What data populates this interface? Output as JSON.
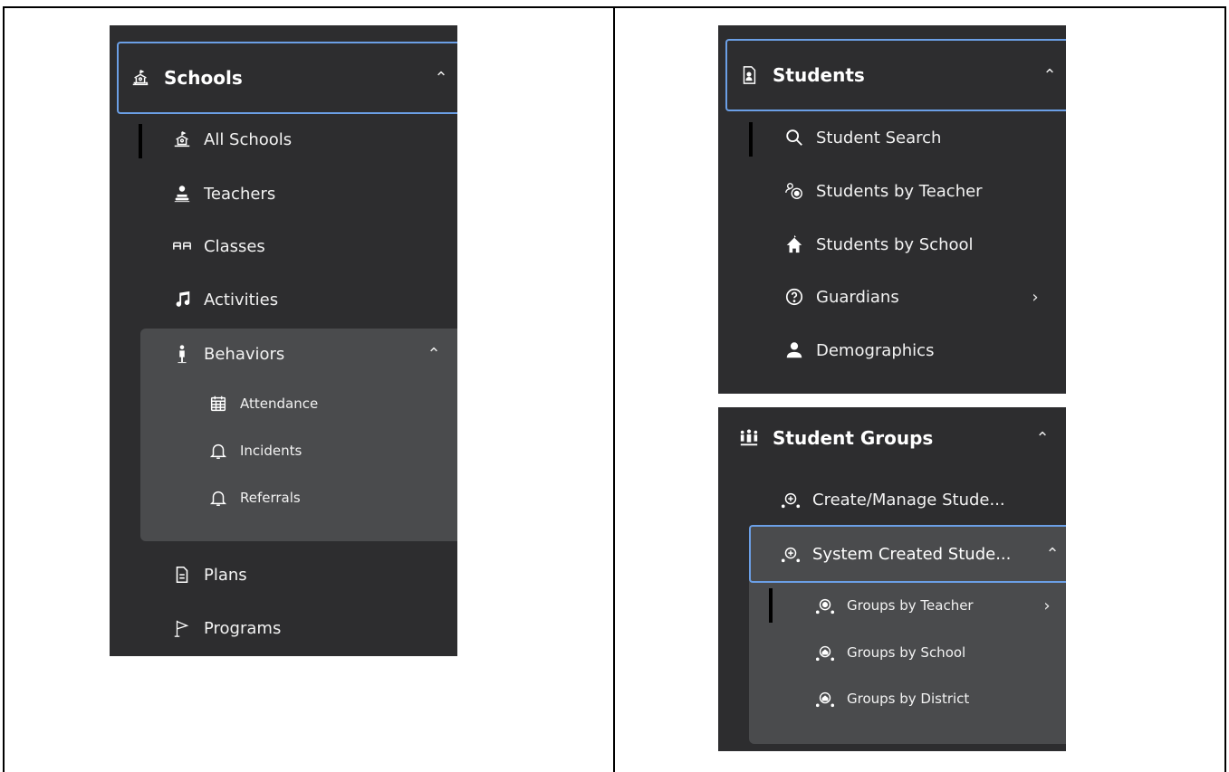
{
  "schools_panel": {
    "header": {
      "label": "Schools",
      "icon": "school-icon"
    },
    "items": [
      {
        "label": "All Schools",
        "icon": "school-icon"
      },
      {
        "label": "Teachers",
        "icon": "teacher-icon"
      },
      {
        "label": "Classes",
        "icon": "classes-icon"
      },
      {
        "label": "Activities",
        "icon": "music-note-icon"
      }
    ],
    "behaviors": {
      "label": "Behaviors",
      "icon": "person-icon",
      "children": [
        {
          "label": "Attendance",
          "icon": "calendar-icon"
        },
        {
          "label": "Incidents",
          "icon": "bell-icon"
        },
        {
          "label": "Referrals",
          "icon": "bell-icon"
        }
      ]
    },
    "bottom_items": [
      {
        "label": "Plans",
        "icon": "document-icon"
      },
      {
        "label": "Programs",
        "icon": "flag-icon"
      }
    ]
  },
  "students_panel": {
    "header": {
      "label": "Students",
      "icon": "student-file-icon"
    },
    "items": [
      {
        "label": "Student Search",
        "icon": "search-icon"
      },
      {
        "label": "Students by Teacher",
        "icon": "people-target-icon"
      },
      {
        "label": "Students by School",
        "icon": "school-building-icon"
      },
      {
        "label": "Guardians",
        "icon": "question-circle-icon"
      },
      {
        "label": "Demographics",
        "icon": "user-icon"
      }
    ]
  },
  "groups_panel": {
    "header": {
      "label": "Student Groups",
      "icon": "group-icon"
    },
    "items": [
      {
        "label": "Create/Manage Stude...",
        "icon": "group-add-icon"
      }
    ],
    "system": {
      "label": "System Created Stude...",
      "icon": "group-add-icon",
      "children": [
        {
          "label": "Groups by Teacher",
          "icon": "group-target-icon"
        },
        {
          "label": "Groups by School",
          "icon": "group-school-icon"
        },
        {
          "label": "Groups by District",
          "icon": "group-school-icon"
        }
      ]
    }
  },
  "colors": {
    "panel": "#2d2d2f",
    "subpanel": "#4a4b4d",
    "focus_border": "#6b9fe6",
    "active_bar": "#000000"
  }
}
